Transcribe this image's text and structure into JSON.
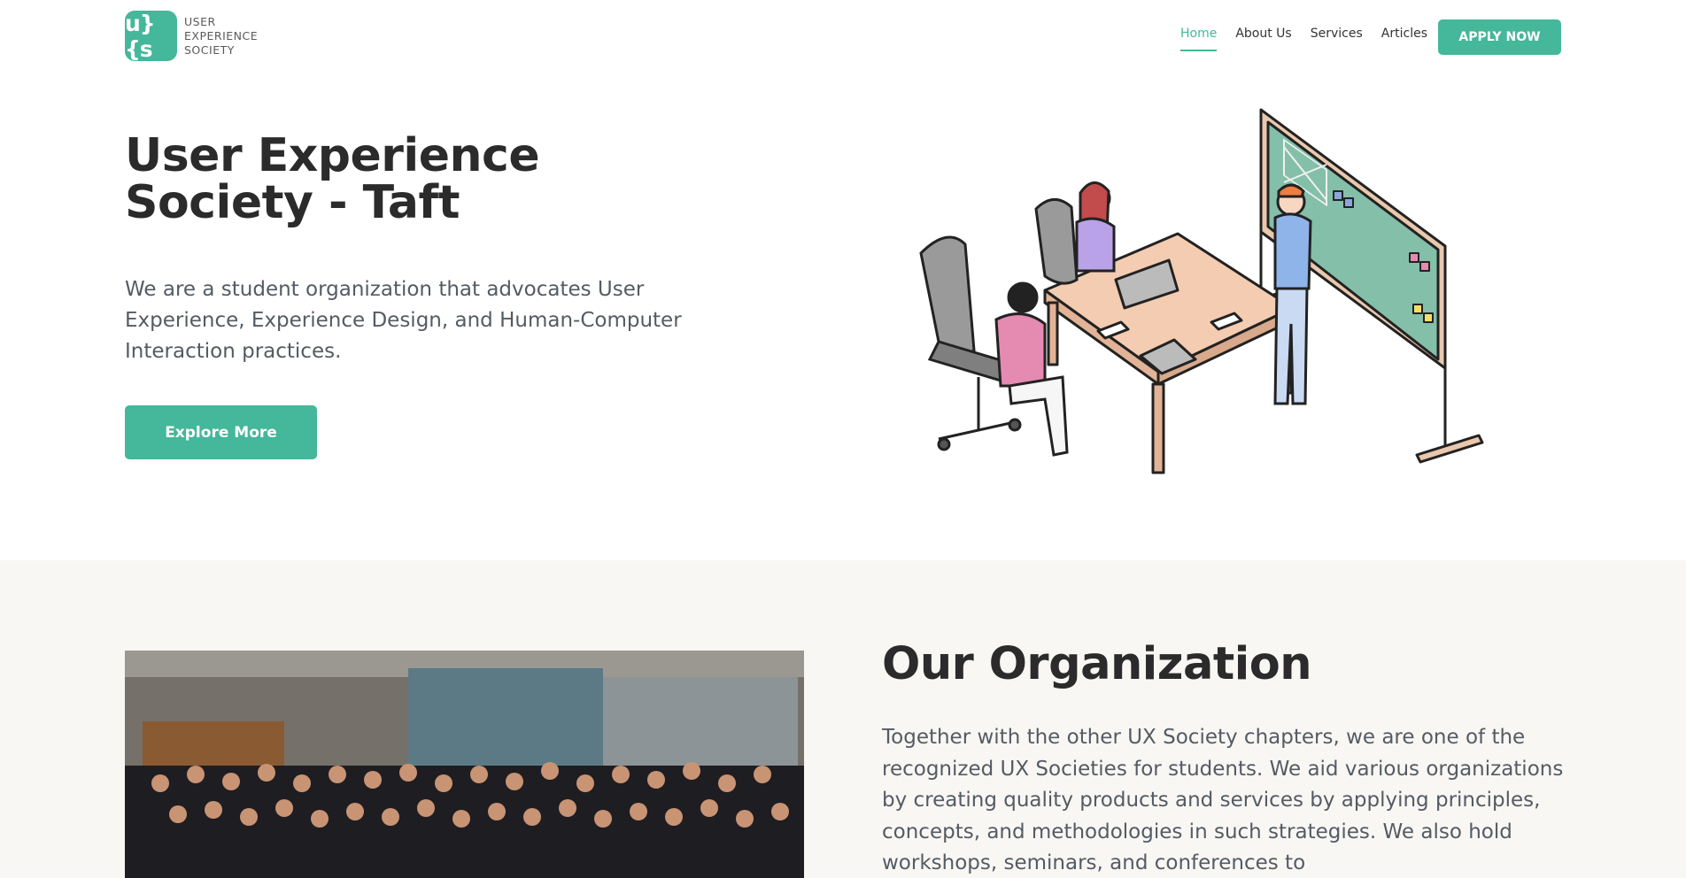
{
  "logo": {
    "mark": "u}{s",
    "lines": [
      "USER",
      "EXPERIENCE",
      "SOCIETY"
    ]
  },
  "nav": {
    "items": [
      {
        "label": "Home",
        "active": true
      },
      {
        "label": "About Us",
        "active": false
      },
      {
        "label": "Services",
        "active": false
      },
      {
        "label": "Articles",
        "active": false
      }
    ],
    "apply_label": "APPLY NOW"
  },
  "hero": {
    "title": "User Experience Society - Taft",
    "description": "We are a student organization that advocates User Experience, Experience Design, and Human-Computer Interaction practices.",
    "button_label": "Explore More"
  },
  "organization": {
    "title": "Our Organization",
    "description": "Together with the other UX Society chapters, we are one of the recognized UX Societies for students. We aid various organizations by creating quality products and services by applying principles, concepts, and methodologies in such strategies. We also hold workshops, seminars, and conferences to"
  },
  "colors": {
    "accent": "#45b79a",
    "section_bg": "#f8f7f4",
    "text_dark": "#2b2b2b",
    "text_body": "#555b63"
  }
}
